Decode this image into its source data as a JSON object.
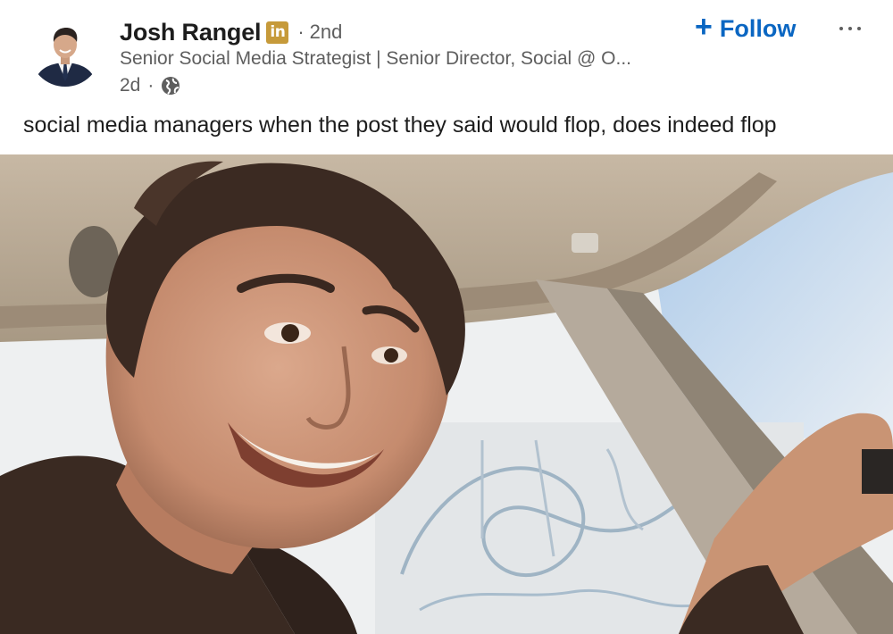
{
  "post": {
    "author": {
      "name": "Josh Rangel",
      "badge": "in",
      "degree": "2nd",
      "headline": "Senior Social Media Strategist | Senior Director, Social @ O...",
      "avatar_icon": "person-in-suit-avatar"
    },
    "time_ago": "2d",
    "visibility_icon": "globe-icon",
    "separator": "·",
    "follow": {
      "plus": "+",
      "label": "Follow"
    },
    "more_icon": "ellipsis-icon",
    "commentary": "social media managers when the post they said would flop, does indeed flop",
    "image_alt": "Smiling man with brown hair in a car, meme photo"
  },
  "colors": {
    "follow_blue": "#0a66c2",
    "linkedin_badge": "#c69a3a",
    "secondary_text": "#5e5e5e",
    "primary_text": "#1d1d1d"
  }
}
